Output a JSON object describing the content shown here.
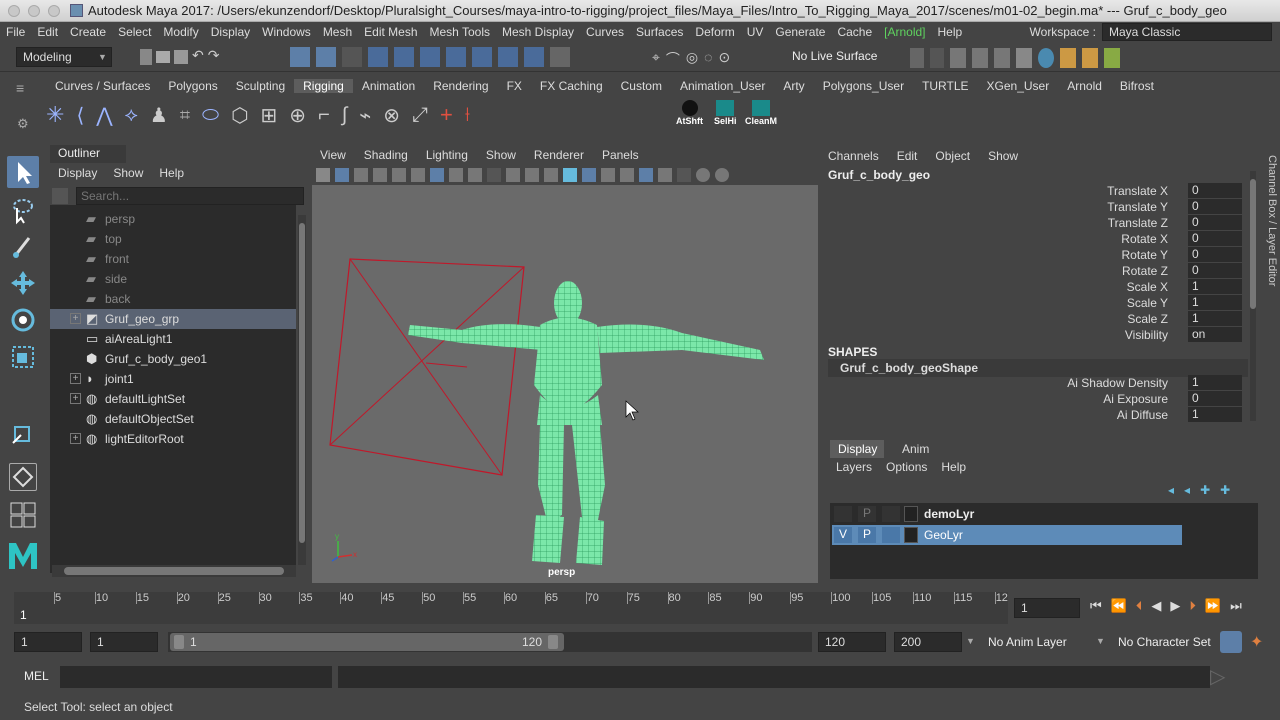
{
  "window": {
    "title": "Autodesk Maya 2017: /Users/ekunzendorf/Desktop/Pluralsight_Courses/maya-intro-to-rigging/project_files/Maya_Files/Intro_To_Rigging_Maya_2017/scenes/m01-02_begin.ma*  ---  Gruf_c_body_geo"
  },
  "menubar": [
    "File",
    "Edit",
    "Create",
    "Select",
    "Modify",
    "Display",
    "Windows",
    "Mesh",
    "Edit Mesh",
    "Mesh Tools",
    "Mesh Display",
    "Curves",
    "Surfaces",
    "Deform",
    "UV",
    "Generate",
    "Cache",
    "[Arnold]",
    "Help"
  ],
  "statusline": {
    "mode": "Modeling",
    "live_surface": "No Live Surface",
    "workspace_label": "Workspace :",
    "workspace_value": "Maya Classic"
  },
  "shelf": {
    "tabs": [
      "Curves / Surfaces",
      "Polygons",
      "Sculpting",
      "Rigging",
      "Animation",
      "Rendering",
      "FX",
      "FX Caching",
      "Custom",
      "Animation_User",
      "Arty",
      "Polygons_User",
      "TURTLE",
      "XGen_User",
      "Arnold",
      "Bifrost"
    ],
    "active_tab": "Rigging",
    "labels": {
      "atshft": "AtShft",
      "selhi": "SelHi",
      "cleanm": "CleanM"
    }
  },
  "outliner": {
    "title": "Outliner",
    "menu": [
      "Display",
      "Show",
      "Help"
    ],
    "search_placeholder": "Search...",
    "items": [
      {
        "label": "persp",
        "dim": true,
        "expand": false,
        "icon": "camera-icon"
      },
      {
        "label": "top",
        "dim": true,
        "expand": false,
        "icon": "camera-icon"
      },
      {
        "label": "front",
        "dim": true,
        "expand": false,
        "icon": "camera-icon"
      },
      {
        "label": "side",
        "dim": true,
        "expand": false,
        "icon": "camera-icon"
      },
      {
        "label": "back",
        "dim": true,
        "expand": false,
        "icon": "camera-icon"
      },
      {
        "label": "Gruf_geo_grp",
        "dim": false,
        "expand": true,
        "selected": true,
        "icon": "group-icon"
      },
      {
        "label": "aiAreaLight1",
        "dim": false,
        "expand": false,
        "icon": "area-light-icon"
      },
      {
        "label": "Gruf_c_body_geo1",
        "dim": false,
        "expand": false,
        "icon": "mesh-icon"
      },
      {
        "label": "joint1",
        "dim": false,
        "expand": true,
        "icon": "joint-icon"
      },
      {
        "label": "defaultLightSet",
        "dim": false,
        "expand": true,
        "icon": "set-icon"
      },
      {
        "label": "defaultObjectSet",
        "dim": false,
        "expand": false,
        "icon": "set-icon"
      },
      {
        "label": "lightEditorRoot",
        "dim": false,
        "expand": true,
        "icon": "set-icon"
      }
    ]
  },
  "viewport": {
    "menu": [
      "View",
      "Shading",
      "Lighting",
      "Show",
      "Renderer",
      "Panels"
    ],
    "camera_label": "persp",
    "axis_y": "y",
    "axis_x": "x"
  },
  "channelbox": {
    "menu": [
      "Channels",
      "Edit",
      "Object",
      "Show"
    ],
    "object": "Gruf_c_body_geo",
    "channels": [
      {
        "name": "Translate X",
        "value": "0"
      },
      {
        "name": "Translate Y",
        "value": "0"
      },
      {
        "name": "Translate Z",
        "value": "0"
      },
      {
        "name": "Rotate X",
        "value": "0"
      },
      {
        "name": "Rotate Y",
        "value": "0"
      },
      {
        "name": "Rotate Z",
        "value": "0"
      },
      {
        "name": "Scale X",
        "value": "1"
      },
      {
        "name": "Scale Y",
        "value": "1"
      },
      {
        "name": "Scale Z",
        "value": "1"
      },
      {
        "name": "Visibility",
        "value": "on"
      }
    ],
    "shapes_header": "SHAPES",
    "shape_name": "Gruf_c_body_geoShape",
    "shape_attrs": [
      {
        "name": "Ai Shadow Density",
        "value": "1"
      },
      {
        "name": "Ai Exposure",
        "value": "0"
      },
      {
        "name": "Ai Diffuse",
        "value": "1"
      }
    ],
    "side_tab": "Channel Box / Layer Editor"
  },
  "layers": {
    "tabs": [
      "Display",
      "Anim"
    ],
    "menu": [
      "Layers",
      "Options",
      "Help"
    ],
    "items": [
      {
        "v": "",
        "p": "P",
        "name": "demoLyr",
        "selected": false
      },
      {
        "v": "V",
        "p": "P",
        "name": "GeoLyr",
        "selected": true
      }
    ]
  },
  "timeline": {
    "ticks": [
      "5",
      "10",
      "15",
      "20",
      "25",
      "30",
      "35",
      "40",
      "45",
      "50",
      "55",
      "60",
      "65",
      "70",
      "75",
      "80",
      "85",
      "90",
      "95",
      "100",
      "105",
      "110",
      "115",
      "12"
    ],
    "start_label": "1",
    "current_frame": "1"
  },
  "range": {
    "start": "1",
    "playback_start": "1",
    "slider_start": "1",
    "slider_end": "120",
    "playback_end": "120",
    "end": "200",
    "anim_layer": "No Anim Layer",
    "character_set": "No Character Set"
  },
  "command": {
    "label": "MEL"
  },
  "help_line": "Select Tool: select an object"
}
